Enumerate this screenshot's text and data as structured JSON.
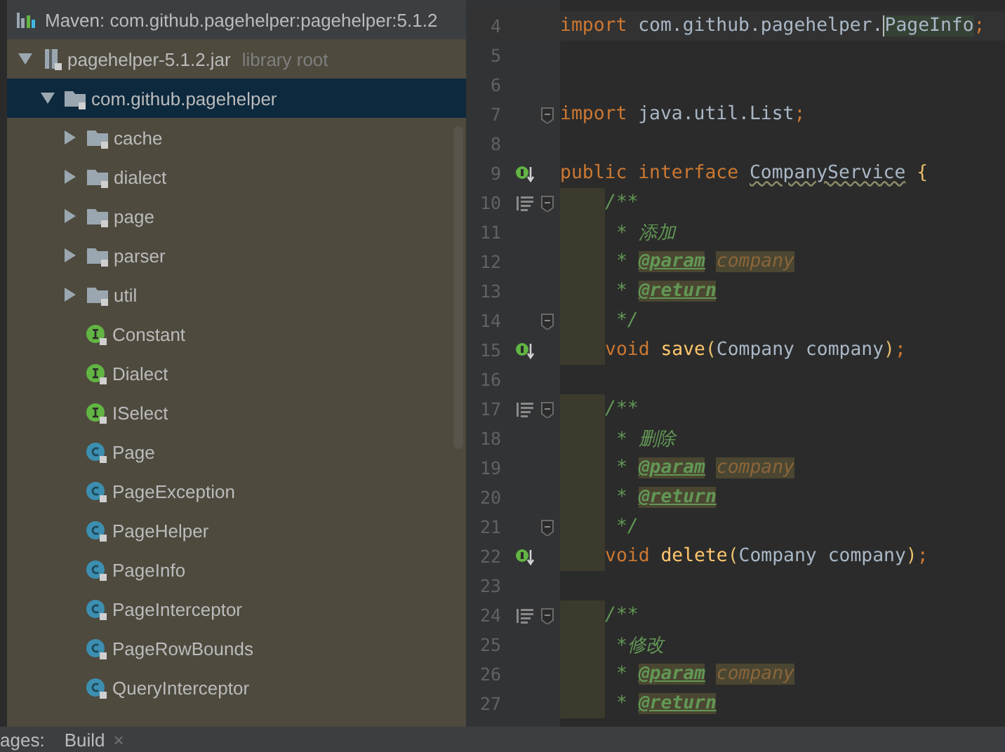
{
  "project_tree": {
    "header": "Maven: com.github.pagehelper:pagehelper:5.1.2",
    "items": [
      {
        "kind": "jar",
        "label": "pagehelper-5.1.2.jar",
        "hint": "library root",
        "expanded": true,
        "selected": false,
        "children": [
          {
            "kind": "package",
            "label": "com.github.pagehelper",
            "expanded": true,
            "selected": true,
            "children": [
              {
                "kind": "folder",
                "label": "cache",
                "expanded": false,
                "selected": false
              },
              {
                "kind": "folder",
                "label": "dialect",
                "expanded": false,
                "selected": false
              },
              {
                "kind": "folder",
                "label": "page",
                "expanded": false,
                "selected": false
              },
              {
                "kind": "folder",
                "label": "parser",
                "expanded": false,
                "selected": false
              },
              {
                "kind": "folder",
                "label": "util",
                "expanded": false,
                "selected": false
              },
              {
                "kind": "interface",
                "label": "Constant",
                "selected": false
              },
              {
                "kind": "interface",
                "label": "Dialect",
                "selected": false
              },
              {
                "kind": "interface",
                "label": "ISelect",
                "selected": false
              },
              {
                "kind": "class",
                "label": "Page",
                "selected": false
              },
              {
                "kind": "class",
                "label": "PageException",
                "selected": false
              },
              {
                "kind": "class",
                "label": "PageHelper",
                "selected": false
              },
              {
                "kind": "class",
                "label": "PageInfo",
                "selected": false
              },
              {
                "kind": "class",
                "label": "PageInterceptor",
                "selected": false
              },
              {
                "kind": "class",
                "label": "PageRowBounds",
                "selected": false
              },
              {
                "kind": "class",
                "label": "QueryInterceptor",
                "selected": false
              }
            ]
          }
        ]
      }
    ]
  },
  "editor": {
    "lines": [
      {
        "number": "4",
        "current": true,
        "tokens": [
          {
            "kind": "keyword",
            "text": "import "
          },
          {
            "kind": "plain",
            "text": "com.github.pagehelper."
          },
          {
            "kind": "plain",
            "text": "PageInfo",
            "caret": true,
            "highlighted": true
          },
          {
            "kind": "keyword",
            "text": ";"
          }
        ]
      },
      {
        "number": "5"
      },
      {
        "number": "6"
      },
      {
        "number": "7",
        "fold": true,
        "tokens": [
          {
            "kind": "keyword",
            "text": "import "
          },
          {
            "kind": "plain",
            "text": "java.util.List"
          },
          {
            "kind": "keyword",
            "text": ";"
          }
        ]
      },
      {
        "number": "8"
      },
      {
        "number": "9",
        "kind": "implemented",
        "tokens": [
          {
            "kind": "keyword",
            "text": "public interface "
          },
          {
            "kind": "plain",
            "text": "CompanyService",
            "warning": true
          },
          {
            "kind": "brace",
            "text": " {"
          }
        ]
      },
      {
        "number": "10",
        "kind": "doc",
        "fold": true,
        "indented": true,
        "tokens": [
          {
            "kind": "comment",
            "text": "/**"
          }
        ]
      },
      {
        "number": "11",
        "indented": true,
        "tokens": [
          {
            "kind": "comment",
            "text": " * 添加"
          }
        ]
      },
      {
        "number": "12",
        "indented": true,
        "tokens": [
          {
            "kind": "comment",
            "text": " * "
          },
          {
            "kind": "tag",
            "text": "@param"
          },
          {
            "kind": "param",
            "text": "company"
          }
        ]
      },
      {
        "number": "13",
        "indented": true,
        "tokens": [
          {
            "kind": "comment",
            "text": " * "
          },
          {
            "kind": "tag",
            "text": "@return"
          }
        ]
      },
      {
        "number": "14",
        "fold": true,
        "indented": true,
        "tokens": [
          {
            "kind": "comment",
            "text": " */"
          }
        ]
      },
      {
        "number": "15",
        "kind": "implemented",
        "indented": true,
        "tokens": [
          {
            "kind": "keyword",
            "text": "void "
          },
          {
            "kind": "method",
            "text": "save"
          },
          {
            "kind": "brace",
            "text": "("
          },
          {
            "kind": "plain",
            "text": "Company company"
          },
          {
            "kind": "brace",
            "text": ")"
          },
          {
            "kind": "keyword",
            "text": ";"
          }
        ]
      },
      {
        "number": "16"
      },
      {
        "number": "17",
        "kind": "doc",
        "fold": true,
        "indented": true,
        "tokens": [
          {
            "kind": "comment",
            "text": "/**"
          }
        ]
      },
      {
        "number": "18",
        "indented": true,
        "tokens": [
          {
            "kind": "comment",
            "text": " * 删除"
          }
        ]
      },
      {
        "number": "19",
        "indented": true,
        "tokens": [
          {
            "kind": "comment",
            "text": " * "
          },
          {
            "kind": "tag",
            "text": "@param"
          },
          {
            "kind": "param",
            "text": "company"
          }
        ]
      },
      {
        "number": "20",
        "indented": true,
        "tokens": [
          {
            "kind": "comment",
            "text": " * "
          },
          {
            "kind": "tag",
            "text": "@return"
          }
        ]
      },
      {
        "number": "21",
        "fold": true,
        "indented": true,
        "tokens": [
          {
            "kind": "comment",
            "text": " */"
          }
        ]
      },
      {
        "number": "22",
        "kind": "implemented",
        "indented": true,
        "tokens": [
          {
            "kind": "keyword",
            "text": "void "
          },
          {
            "kind": "method",
            "text": "delete"
          },
          {
            "kind": "brace",
            "text": "("
          },
          {
            "kind": "plain",
            "text": "Company company"
          },
          {
            "kind": "brace",
            "text": ")"
          },
          {
            "kind": "keyword",
            "text": ";"
          }
        ]
      },
      {
        "number": "23"
      },
      {
        "number": "24",
        "kind": "doc",
        "fold": true,
        "indented": true,
        "tokens": [
          {
            "kind": "comment",
            "text": "/**"
          }
        ]
      },
      {
        "number": "25",
        "indented": true,
        "tokens": [
          {
            "kind": "comment",
            "text": " *修改"
          }
        ]
      },
      {
        "number": "26",
        "indented": true,
        "tokens": [
          {
            "kind": "comment",
            "text": " * "
          },
          {
            "kind": "tag",
            "text": "@param"
          },
          {
            "kind": "param",
            "text": "company"
          }
        ]
      },
      {
        "number": "27",
        "indented": true,
        "tokens": [
          {
            "kind": "comment",
            "text": " * "
          },
          {
            "kind": "tag",
            "text": "@return"
          }
        ]
      }
    ]
  },
  "bottom_bar": {
    "label": "ages:",
    "tabs": [
      {
        "label": "Build",
        "close": "×"
      }
    ]
  }
}
